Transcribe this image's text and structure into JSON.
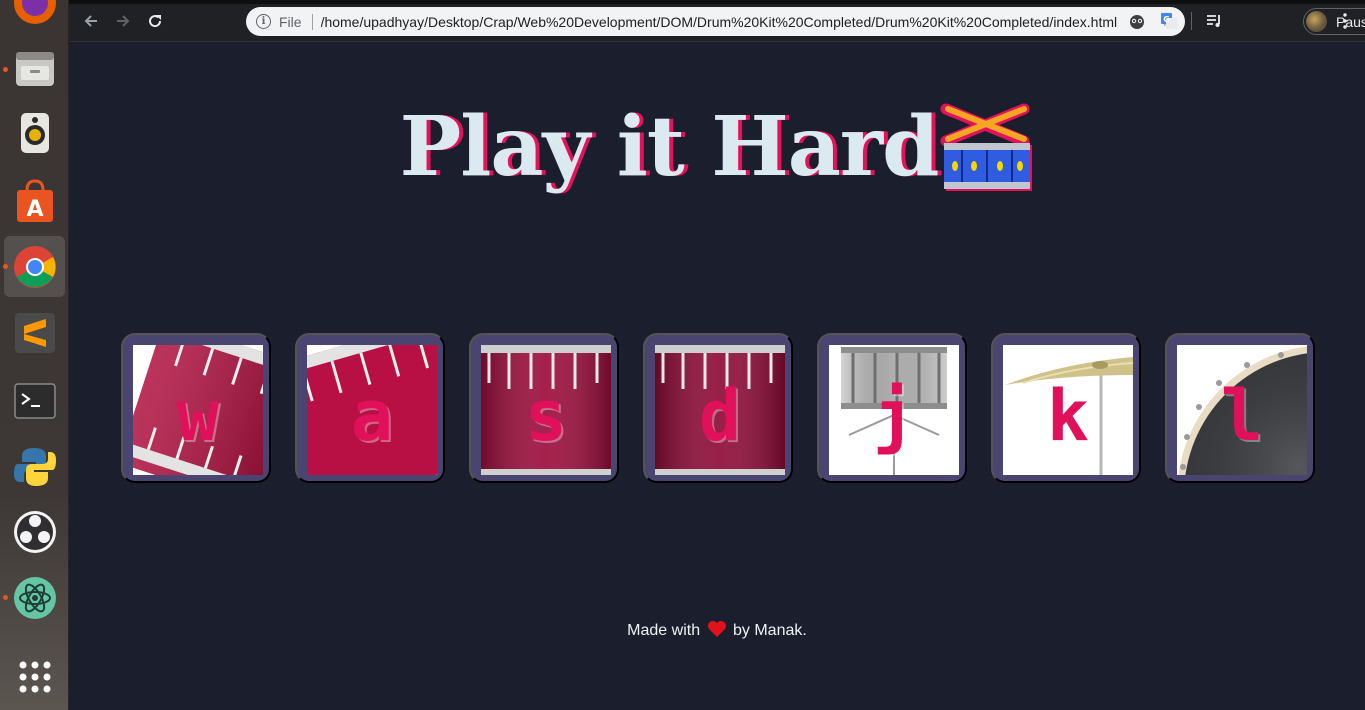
{
  "browser": {
    "scheme_label": "File",
    "url": "/home/upadhyay/Desktop/Crap/Web%20Development/DOM/Drum%20Kit%20Completed/Drum%20Kit%20Completed/index.html",
    "profile_label": "Paused",
    "toolbar_icons": [
      "back-arrow-icon",
      "forward-arrow-icon",
      "reload-icon",
      "info-icon",
      "star-icon",
      "extension-icon",
      "translate-icon",
      "media-control-icon",
      "kebab-menu-icon"
    ]
  },
  "dock": {
    "apps": [
      {
        "name": "firefox",
        "running": true
      },
      {
        "name": "files",
        "running": true
      },
      {
        "name": "rhythmbox",
        "running": false
      },
      {
        "name": "software-center",
        "running": false
      },
      {
        "name": "chrome",
        "running": true,
        "active": true
      },
      {
        "name": "sublime-text",
        "running": false
      },
      {
        "name": "terminal",
        "running": false
      },
      {
        "name": "python",
        "running": false
      },
      {
        "name": "obs-studio",
        "running": false
      },
      {
        "name": "atom",
        "running": true
      },
      {
        "name": "show-applications",
        "running": false
      }
    ]
  },
  "page": {
    "title": "Play it Hard",
    "title_emoji": "drum-emoji",
    "drums": [
      {
        "key": "w",
        "image": "tom"
      },
      {
        "key": "a",
        "image": "tom"
      },
      {
        "key": "s",
        "image": "bass-drum"
      },
      {
        "key": "d",
        "image": "bass-drum"
      },
      {
        "key": "j",
        "image": "snare"
      },
      {
        "key": "k",
        "image": "crash-cymbal"
      },
      {
        "key": "l",
        "image": "kick"
      }
    ],
    "footer": {
      "prefix": "Made with",
      "suffix": "by Manak."
    }
  },
  "colors": {
    "page_background": "#1b1f2d",
    "title_text": "#dbe9f1",
    "title_shadow": "#e5115a",
    "drum_border": "#4a4570",
    "key_text": "#e0115a"
  }
}
